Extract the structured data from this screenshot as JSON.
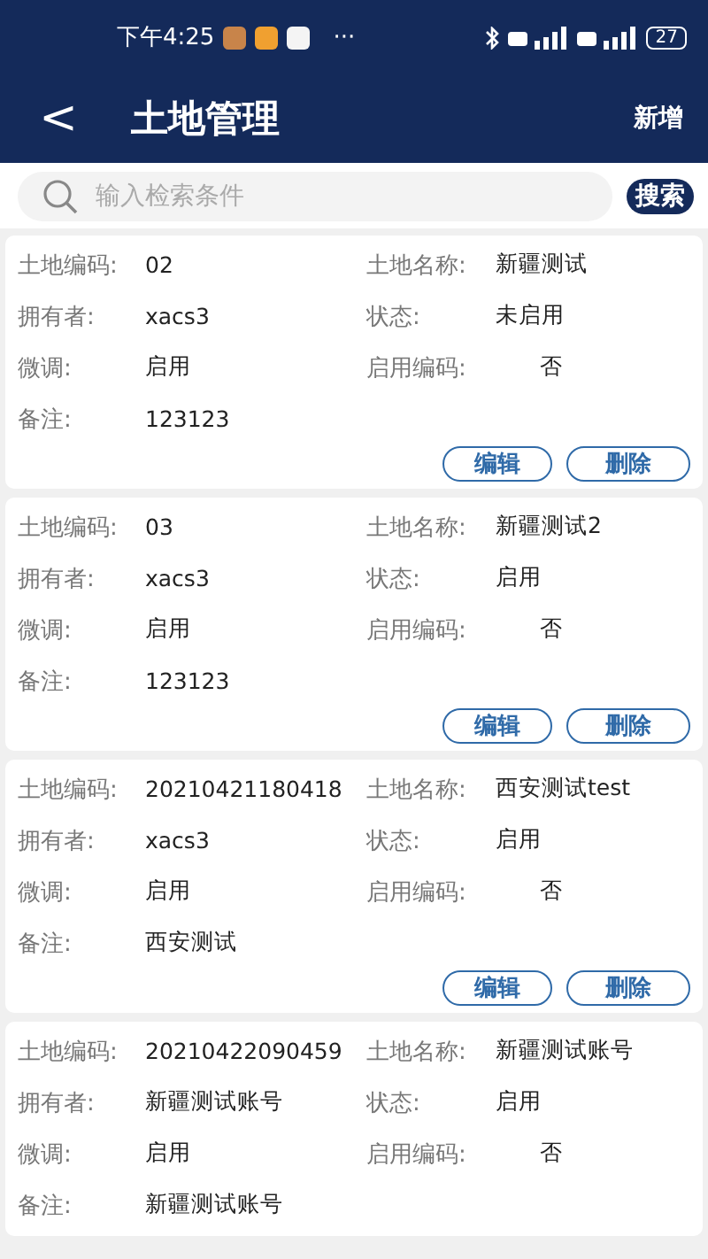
{
  "status_bar": {
    "time": "下午4:25",
    "more": "···",
    "battery": "27"
  },
  "header": {
    "back": "<",
    "title": "土地管理",
    "action": "新增"
  },
  "search": {
    "placeholder": "输入检索条件",
    "button": "搜索"
  },
  "cards": [
    {
      "fields": [
        {
          "label": "土地编码:",
          "value": "02"
        },
        {
          "label": "土地名称:",
          "value": "新疆测试"
        },
        {
          "label": "拥有者:",
          "value": "xacs3"
        },
        {
          "label": "状态:",
          "value": "未启用"
        },
        {
          "label": "微调:",
          "value": "启用"
        },
        {
          "label": "启用编码:",
          "value": "否"
        },
        {
          "label": "备注:",
          "value": "123123"
        }
      ],
      "buttons": [
        "编辑",
        "删除"
      ]
    },
    {
      "fields": [
        {
          "label": "土地编码:",
          "value": "03"
        },
        {
          "label": "土地名称:",
          "value": "新疆测试2"
        },
        {
          "label": "拥有者:",
          "value": "xacs3"
        },
        {
          "label": "状态:",
          "value": "启用"
        },
        {
          "label": "微调:",
          "value": "启用"
        },
        {
          "label": "启用编码:",
          "value": "否"
        },
        {
          "label": "备注:",
          "value": "123123"
        }
      ],
      "buttons": [
        "编辑",
        "删除"
      ]
    },
    {
      "fields": [
        {
          "label": "土地编码:",
          "value": "20210421180418"
        },
        {
          "label": "土地名称:",
          "value": "西安测试test"
        },
        {
          "label": "拥有者:",
          "value": "xacs3"
        },
        {
          "label": "状态:",
          "value": "启用"
        },
        {
          "label": "微调:",
          "value": "启用"
        },
        {
          "label": "启用编码:",
          "value": "否"
        },
        {
          "label": "备注:",
          "value": "西安测试"
        }
      ],
      "buttons": [
        "编辑",
        "删除"
      ]
    },
    {
      "fields": [
        {
          "label": "土地编码:",
          "value": "20210422090459"
        },
        {
          "label": "土地名称:",
          "value": "新疆测试账号"
        },
        {
          "label": "拥有者:",
          "value": "新疆测试账号"
        },
        {
          "label": "状态:",
          "value": "启用"
        },
        {
          "label": "微调:",
          "value": "启用"
        },
        {
          "label": "启用编码:",
          "value": "否"
        },
        {
          "label": "备注:",
          "value": "新疆测试账号"
        }
      ]
    }
  ]
}
